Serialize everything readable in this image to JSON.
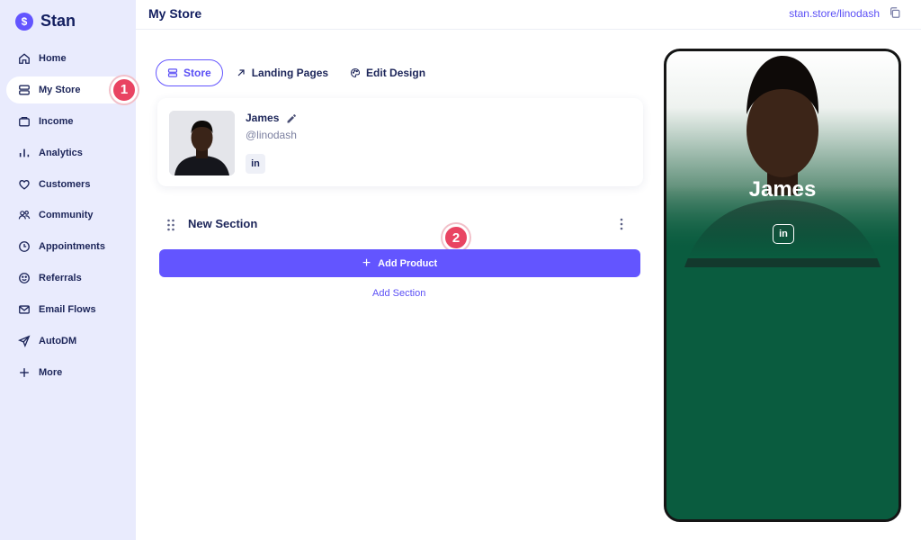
{
  "app": {
    "brand": "Stan",
    "logo_glyph": "$"
  },
  "sidebar": {
    "items": [
      {
        "label": "Home",
        "icon": "home-icon"
      },
      {
        "label": "My Store",
        "icon": "store-icon",
        "active": true
      },
      {
        "label": "Income",
        "icon": "wallet-icon"
      },
      {
        "label": "Analytics",
        "icon": "bar-chart-icon"
      },
      {
        "label": "Customers",
        "icon": "heart-icon"
      },
      {
        "label": "Community",
        "icon": "users-icon"
      },
      {
        "label": "Appointments",
        "icon": "clock-icon"
      },
      {
        "label": "Referrals",
        "icon": "smiley-icon"
      },
      {
        "label": "Email Flows",
        "icon": "mail-icon"
      },
      {
        "label": "AutoDM",
        "icon": "send-icon"
      },
      {
        "label": "More",
        "icon": "plus-icon"
      }
    ]
  },
  "header": {
    "title": "My Store",
    "store_url": "stan.store/linodash"
  },
  "tabs": [
    {
      "label": "Store",
      "icon": "layers-icon",
      "active": true
    },
    {
      "label": "Landing Pages",
      "icon": "arrow-up-right-icon"
    },
    {
      "label": "Edit Design",
      "icon": "palette-icon"
    }
  ],
  "profile": {
    "name": "James",
    "handle": "@linodash",
    "social": "in"
  },
  "section": {
    "title": "New Section",
    "add_product_label": "Add Product",
    "add_section_label": "Add Section"
  },
  "steps": {
    "step1": "1",
    "step2": "2"
  },
  "preview": {
    "name": "James",
    "social": "in"
  },
  "colors": {
    "accent": "#6355ff",
    "sidebar_bg": "#e9ebfd",
    "badge": "#e94462",
    "preview_bg": "#0a5c3f"
  }
}
